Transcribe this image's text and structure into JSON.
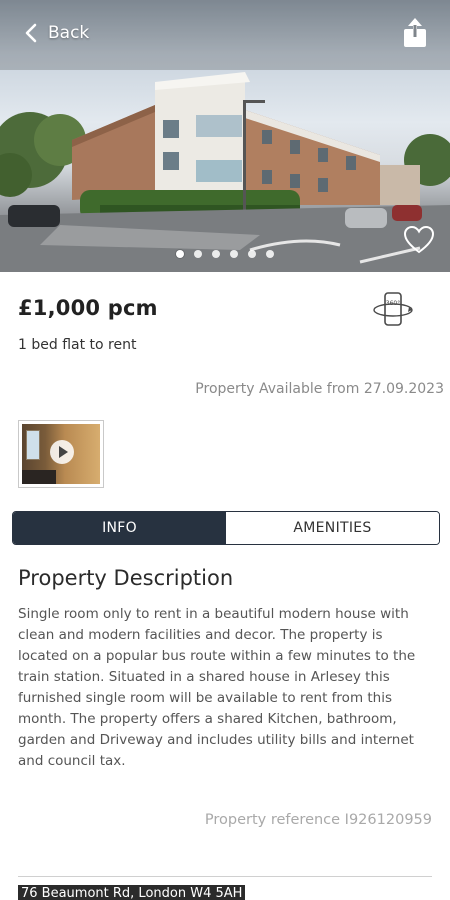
{
  "header": {
    "back_label": "Back"
  },
  "gallery": {
    "slide_count": 6,
    "active_slide": 1
  },
  "listing": {
    "price": "£1,000 pcm",
    "subtitle": "1 bed flat to rent",
    "availability": "Property Available from 27.09.2023",
    "tour_icon": "360-view-icon"
  },
  "tabs": [
    {
      "label": "INFO",
      "active": true
    },
    {
      "label": "AMENITIES",
      "active": false
    }
  ],
  "description": {
    "title": "Property Description",
    "body": "Single room only to rent in a beautiful modern house with clean and modern facilities and decor. The property is located on a popular bus route within a few minutes to the train station. Situated in a shared house in Arlesey this furnished single room will be available to rent from this month. The property offers a shared Kitchen, bathroom, garden and Driveway and includes utility bills and internet and council tax.",
    "reference": "Property reference I926120959"
  },
  "address": "76 Beaumont Rd, London W4 5AH",
  "colors": {
    "tab_active_bg": "#273240",
    "text_muted": "#8a8a8a"
  }
}
